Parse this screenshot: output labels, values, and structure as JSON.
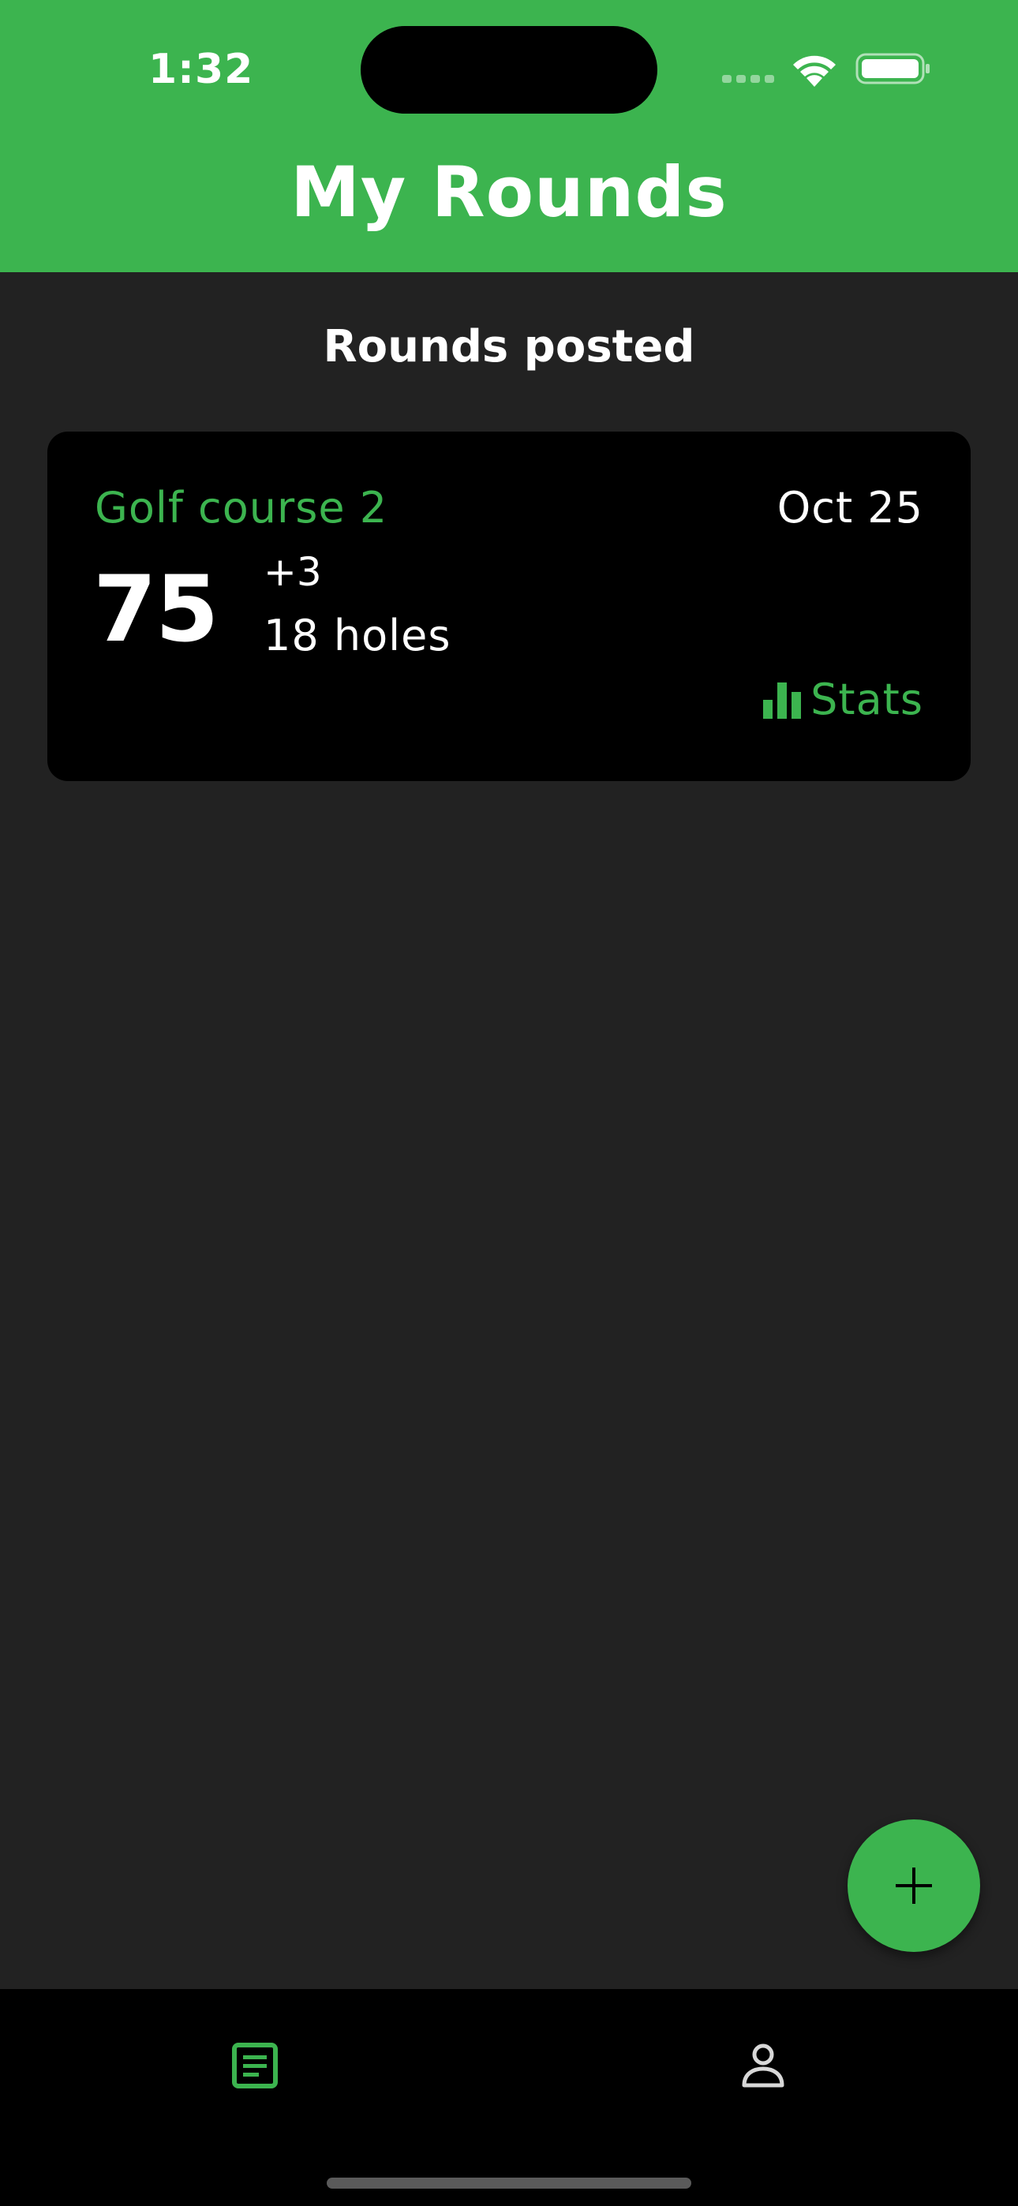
{
  "status_bar": {
    "time": "1:32",
    "icons": [
      "signal-icon",
      "wifi-icon",
      "battery-icon"
    ]
  },
  "header": {
    "title": "My Rounds"
  },
  "section": {
    "heading": "Rounds posted"
  },
  "rounds": [
    {
      "course": "Golf course 2",
      "date": "Oct 25",
      "score": "75",
      "to_par": "+3",
      "holes": "18 holes",
      "stats_label": "Stats",
      "stats_icon": "bar-chart-icon"
    }
  ],
  "fab": {
    "icon": "plus-icon"
  },
  "bottom_nav": {
    "items": [
      {
        "icon": "document-icon",
        "active": true
      },
      {
        "icon": "person-icon",
        "active": false
      }
    ]
  },
  "colors": {
    "accent": "#3cb44f",
    "background": "#222222",
    "card": "#000000",
    "text": "#ffffff",
    "inactive_icon": "#d8d8d8"
  }
}
